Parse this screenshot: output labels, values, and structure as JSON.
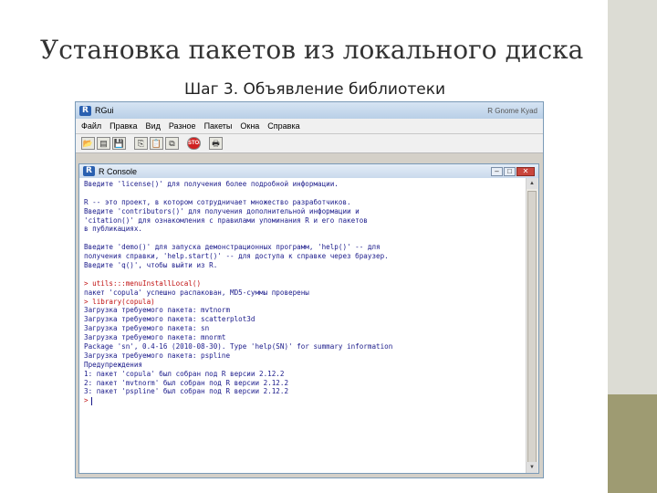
{
  "slide": {
    "title": "Установка пакетов из локального диска",
    "subtitle": "Шаг 3. Объявление библиотеки"
  },
  "rgui": {
    "title": "RGui",
    "title_right": "R Gnome Kyad",
    "menu": [
      "Файл",
      "Правка",
      "Вид",
      "Разное",
      "Пакеты",
      "Окна",
      "Справка"
    ],
    "toolbar": {
      "open_script": "📂",
      "load_workspace": "▤",
      "save_workspace": "💾",
      "copy": "⎘",
      "paste": "📋",
      "copy_paste": "⧉",
      "stop": "STOP",
      "print": "🖶"
    }
  },
  "console": {
    "title": "R Console",
    "lines": [
      {
        "type": "out",
        "text": "Введите 'license()' для получения более подробной информации."
      },
      {
        "type": "out",
        "text": ""
      },
      {
        "type": "out",
        "text": "R -- это проект, в котором сотрудничает множество разработчиков."
      },
      {
        "type": "out",
        "text": "Введите 'contributors()' для получения дополнительной информации и"
      },
      {
        "type": "out",
        "text": "'citation()' для ознакомления с правилами упоминания R и его пакетов"
      },
      {
        "type": "out",
        "text": "в публикациях."
      },
      {
        "type": "out",
        "text": ""
      },
      {
        "type": "out",
        "text": "Введите 'demo()' для запуска демонстрационных программ, 'help()' -- для"
      },
      {
        "type": "out",
        "text": "получения справки, 'help.start()' -- для доступа к справке через браузер."
      },
      {
        "type": "out",
        "text": "Введите 'q()', чтобы выйти из R."
      },
      {
        "type": "out",
        "text": ""
      },
      {
        "type": "cmd",
        "text": "> utils:::menuInstallLocal()"
      },
      {
        "type": "out",
        "text": "пакет 'copula' успешно распакован, MD5-суммы проверены"
      },
      {
        "type": "cmd",
        "text": "> library(copula)"
      },
      {
        "type": "out",
        "text": "Загрузка требуемого пакета: mvtnorm"
      },
      {
        "type": "out",
        "text": "Загрузка требуемого пакета: scatterplot3d"
      },
      {
        "type": "out",
        "text": "Загрузка требуемого пакета: sn"
      },
      {
        "type": "out",
        "text": "Загрузка требуемого пакета: mnormt"
      },
      {
        "type": "out",
        "text": "Package 'sn', 0.4-16 (2010-08-30). Type 'help(SN)' for summary information"
      },
      {
        "type": "out",
        "text": "Загрузка требуемого пакета: pspline"
      },
      {
        "type": "out",
        "text": "Предупреждения"
      },
      {
        "type": "out",
        "text": "1: пакет 'copula' был собран под R версии 2.12.2"
      },
      {
        "type": "out",
        "text": "2: пакет 'mvtnorm' был собран под R версии 2.12.2"
      },
      {
        "type": "out",
        "text": "3: пакет 'pspline' был собран под R версии 2.12.2"
      },
      {
        "type": "cmd",
        "text": ">"
      }
    ]
  }
}
